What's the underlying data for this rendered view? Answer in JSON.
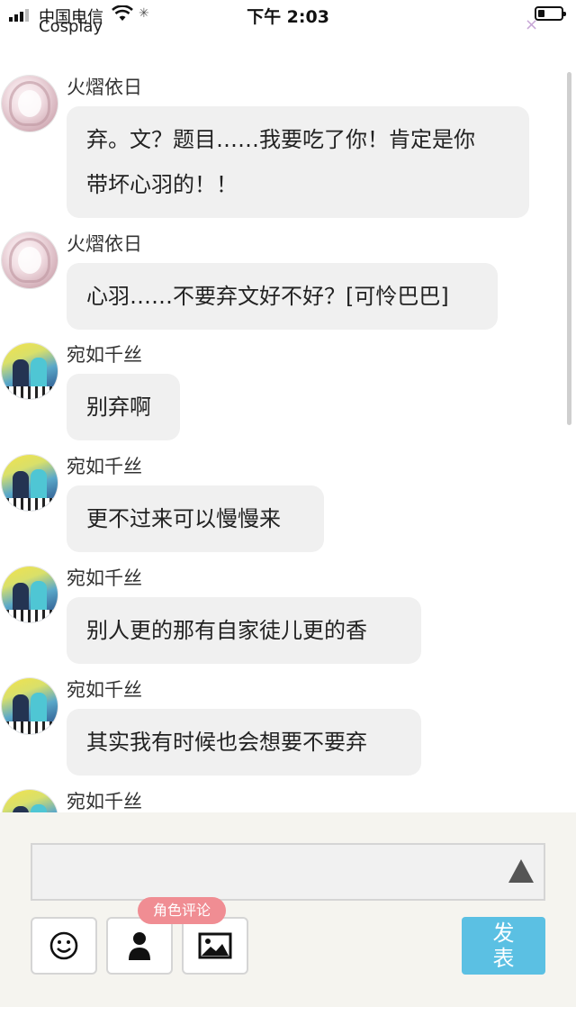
{
  "status_bar": {
    "carrier": "中国电信",
    "time": "下午 2:03"
  },
  "app": {
    "title": "Cosplay",
    "close_glyph": "×"
  },
  "messages": [
    {
      "sender": "火熠依日",
      "avatar": "pink-avatar",
      "lines": [
        "弃。文？题目……我要吃了你！肯定是你",
        "带坏心羽的！！"
      ]
    },
    {
      "sender": "火熠依日",
      "avatar": "pink-avatar",
      "lines": [
        "心羽……不要弃文好不好？[可怜巴巴]"
      ]
    },
    {
      "sender": "宛如千丝",
      "avatar": "blue-avatar",
      "lines": [
        "别弃啊"
      ]
    },
    {
      "sender": "宛如千丝",
      "avatar": "blue-avatar",
      "lines": [
        "更不过来可以慢慢来"
      ]
    },
    {
      "sender": "宛如千丝",
      "avatar": "blue-avatar",
      "lines": [
        "别人更的那有自家徒儿更的香"
      ]
    },
    {
      "sender": "宛如千丝",
      "avatar": "blue-avatar",
      "lines": [
        "其实我有时候也会想要不要弃"
      ]
    },
    {
      "sender": "宛如千丝",
      "avatar": "blue-avatar",
      "lines": []
    }
  ],
  "composer": {
    "input_value": "",
    "expand_icon": "triangle-up-icon",
    "tools": [
      {
        "name": "emoji-button",
        "icon": "smiley-icon"
      },
      {
        "name": "role-button",
        "icon": "person-icon"
      },
      {
        "name": "image-button",
        "icon": "image-icon"
      }
    ],
    "role_tooltip": "角色评论",
    "send_label": "发表"
  },
  "colors": {
    "send_button": "#5bc0e3",
    "role_tooltip": "#f08d93",
    "bubble": "#f0f0f0",
    "composer_bg": "#f5f4ef"
  }
}
